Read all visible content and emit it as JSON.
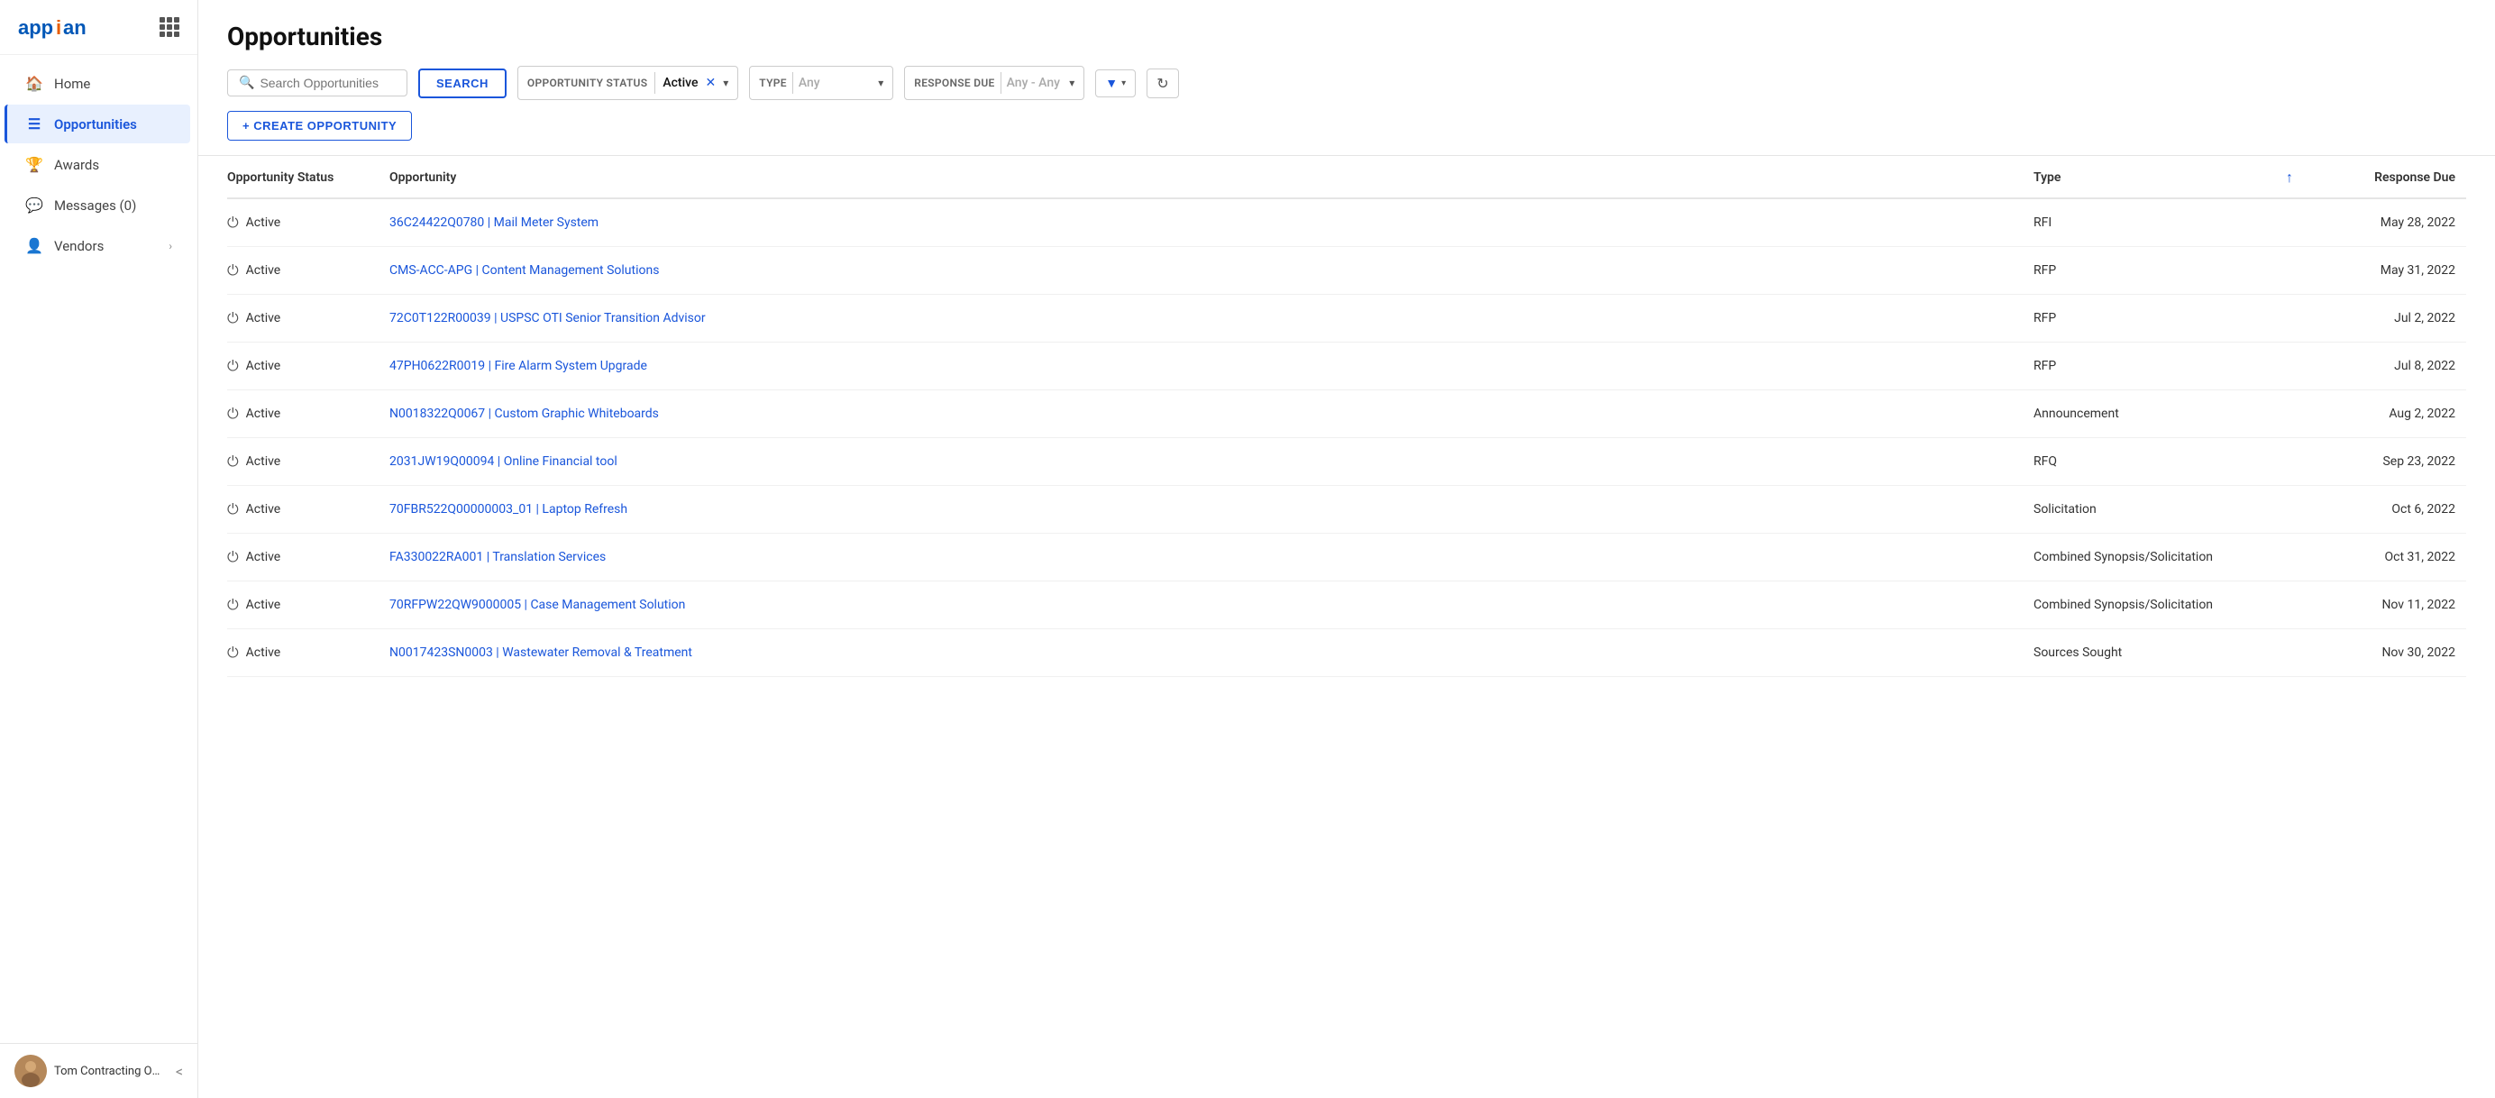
{
  "app": {
    "logo": "appian",
    "grid_icon": "grid-icon"
  },
  "sidebar": {
    "nav_items": [
      {
        "id": "home",
        "label": "Home",
        "icon": "🏠",
        "active": false
      },
      {
        "id": "opportunities",
        "label": "Opportunities",
        "icon": "☰",
        "active": true
      },
      {
        "id": "awards",
        "label": "Awards",
        "icon": "💬",
        "active": false
      },
      {
        "id": "messages",
        "label": "Messages (0)",
        "icon": "🗨",
        "active": false
      },
      {
        "id": "vendors",
        "label": "Vendors",
        "icon": "👤",
        "active": false,
        "has_chevron": true
      }
    ],
    "user": {
      "name": "Tom Contracting Offi...",
      "collapse_label": "<"
    }
  },
  "page": {
    "title": "Opportunities"
  },
  "toolbar": {
    "search_placeholder": "Search Opportunities",
    "search_btn_label": "SEARCH",
    "opportunity_status_label": "OPPORTUNITY STATUS",
    "opportunity_status_value": "Active",
    "type_label": "TYPE",
    "type_value": "Any",
    "response_due_label": "RESPONSE DUE",
    "response_due_value": "Any - Any",
    "create_btn_label": "+ CREATE OPPORTUNITY"
  },
  "table": {
    "columns": [
      {
        "id": "status",
        "label": "Opportunity Status"
      },
      {
        "id": "opportunity",
        "label": "Opportunity"
      },
      {
        "id": "type",
        "label": "Type"
      },
      {
        "id": "sort",
        "label": "↑",
        "sort_active": true
      },
      {
        "id": "response_due",
        "label": "Response Due"
      }
    ],
    "rows": [
      {
        "status": "Active",
        "opportunity": "36C24422Q0780 | Mail Meter System",
        "type": "RFI",
        "response_due": "May 28, 2022"
      },
      {
        "status": "Active",
        "opportunity": "CMS-ACC-APG | Content Management Solutions",
        "type": "RFP",
        "response_due": "May 31, 2022"
      },
      {
        "status": "Active",
        "opportunity": "72C0T122R00039 | USPSC OTI Senior Transition Advisor",
        "type": "RFP",
        "response_due": "Jul 2, 2022"
      },
      {
        "status": "Active",
        "opportunity": "47PH0622R0019 | Fire Alarm System Upgrade",
        "type": "RFP",
        "response_due": "Jul 8, 2022"
      },
      {
        "status": "Active",
        "opportunity": "N0018322Q0067 | Custom Graphic Whiteboards",
        "type": "Announcement",
        "response_due": "Aug 2, 2022"
      },
      {
        "status": "Active",
        "opportunity": "2031JW19Q00094 | Online Financial tool",
        "type": "RFQ",
        "response_due": "Sep 23, 2022"
      },
      {
        "status": "Active",
        "opportunity": "70FBR522Q00000003_01 | Laptop Refresh",
        "type": "Solicitation",
        "response_due": "Oct 6, 2022"
      },
      {
        "status": "Active",
        "opportunity": "FA330022RA001 | Translation Services",
        "type": "Combined Synopsis/Solicitation",
        "response_due": "Oct 31, 2022"
      },
      {
        "status": "Active",
        "opportunity": "70RFPW22QW9000005 | Case Management Solution",
        "type": "Combined Synopsis/Solicitation",
        "response_due": "Nov 11, 2022"
      },
      {
        "status": "Active",
        "opportunity": "N0017423SN0003 | Wastewater Removal & Treatment",
        "type": "Sources Sought",
        "response_due": "Nov 30, 2022"
      }
    ]
  }
}
